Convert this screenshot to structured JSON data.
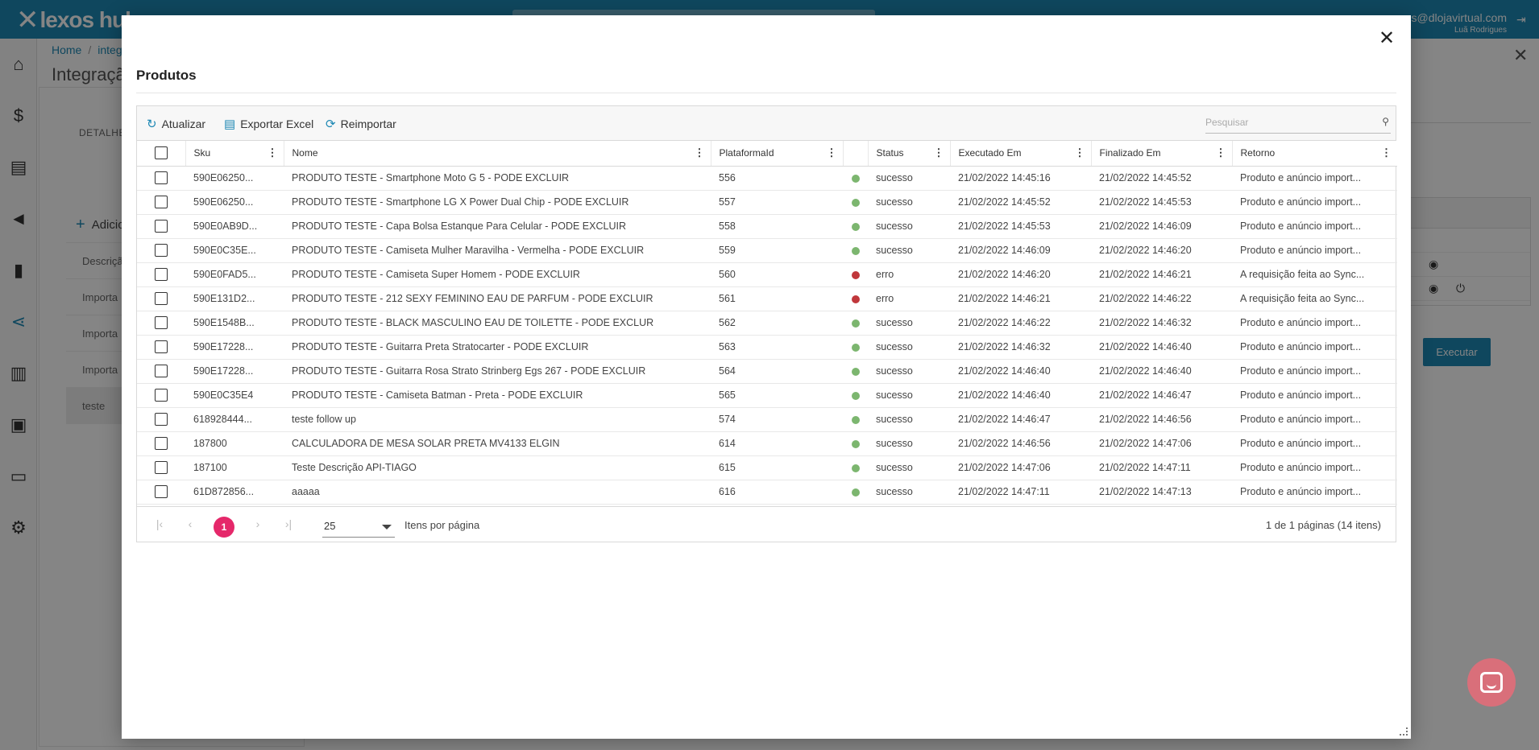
{
  "app": {
    "logo_text": "lexos hub",
    "user_email": "s@dlojavirtual.com",
    "user_name": "Luã Rodrigues"
  },
  "background": {
    "breadcrumb": [
      "Home",
      "integ"
    ],
    "page_title": "Integraçã",
    "detalhe_label": "DETALHE",
    "add_label": "Adicio",
    "list_rows": [
      "Descriçã",
      "Importa",
      "Importa",
      "Importa",
      "teste"
    ],
    "execute_label": "Executar"
  },
  "modal": {
    "title": "Produtos",
    "toolbar": {
      "refresh": "Atualizar",
      "export": "Exportar Excel",
      "reimport": "Reimportar",
      "search_placeholder": "Pesquisar"
    },
    "columns": [
      "Sku",
      "Nome",
      "PlataformaId",
      "Status",
      "Executado Em",
      "Finalizado Em",
      "Retorno"
    ],
    "rows": [
      {
        "sku": "590E06250...",
        "nome": "PRODUTO TESTE - Smartphone Moto G 5 - PODE EXCLUIR",
        "plat": "556",
        "ok": true,
        "status": "sucesso",
        "exec": "21/02/2022 14:45:16",
        "fin": "21/02/2022 14:45:52",
        "ret": "Produto e anúncio import..."
      },
      {
        "sku": "590E06250...",
        "nome": "PRODUTO TESTE - Smartphone LG X Power Dual Chip - PODE EXCLUIR",
        "plat": "557",
        "ok": true,
        "status": "sucesso",
        "exec": "21/02/2022 14:45:52",
        "fin": "21/02/2022 14:45:53",
        "ret": "Produto e anúncio import..."
      },
      {
        "sku": "590E0AB9D...",
        "nome": "PRODUTO TESTE - Capa Bolsa Estanque Para Celular - PODE EXCLUIR",
        "plat": "558",
        "ok": true,
        "status": "sucesso",
        "exec": "21/02/2022 14:45:53",
        "fin": "21/02/2022 14:46:09",
        "ret": "Produto e anúncio import..."
      },
      {
        "sku": "590E0C35E...",
        "nome": "PRODUTO TESTE - Camiseta Mulher Maravilha - Vermelha - PODE EXCLUIR",
        "plat": "559",
        "ok": true,
        "status": "sucesso",
        "exec": "21/02/2022 14:46:09",
        "fin": "21/02/2022 14:46:20",
        "ret": "Produto e anúncio import..."
      },
      {
        "sku": "590E0FAD5...",
        "nome": "PRODUTO TESTE - Camiseta Super Homem - PODE EXCLUIR",
        "plat": "560",
        "ok": false,
        "status": "erro",
        "exec": "21/02/2022 14:46:20",
        "fin": "21/02/2022 14:46:21",
        "ret": "A requisição feita ao Sync..."
      },
      {
        "sku": "590E131D2...",
        "nome": "PRODUTO TESTE - 212 SEXY FEMININO EAU DE PARFUM - PODE EXCLUIR",
        "plat": "561",
        "ok": false,
        "status": "erro",
        "exec": "21/02/2022 14:46:21",
        "fin": "21/02/2022 14:46:22",
        "ret": "A requisição feita ao Sync..."
      },
      {
        "sku": "590E1548B...",
        "nome": "PRODUTO TESTE - BLACK MASCULINO EAU DE TOILETTE - PODE EXCLUR",
        "plat": "562",
        "ok": true,
        "status": "sucesso",
        "exec": "21/02/2022 14:46:22",
        "fin": "21/02/2022 14:46:32",
        "ret": "Produto e anúncio import..."
      },
      {
        "sku": "590E17228...",
        "nome": "PRODUTO TESTE - Guitarra Preta Stratocarter - PODE EXCLUIR",
        "plat": "563",
        "ok": true,
        "status": "sucesso",
        "exec": "21/02/2022 14:46:32",
        "fin": "21/02/2022 14:46:40",
        "ret": "Produto e anúncio import..."
      },
      {
        "sku": "590E17228...",
        "nome": "PRODUTO TESTE - Guitarra Rosa Strato Strinberg Egs 267 - PODE EXCLUIR",
        "plat": "564",
        "ok": true,
        "status": "sucesso",
        "exec": "21/02/2022 14:46:40",
        "fin": "21/02/2022 14:46:40",
        "ret": "Produto e anúncio import..."
      },
      {
        "sku": "590E0C35E4",
        "nome": "PRODUTO TESTE - Camiseta Batman - Preta - PODE EXCLUIR",
        "plat": "565",
        "ok": true,
        "status": "sucesso",
        "exec": "21/02/2022 14:46:40",
        "fin": "21/02/2022 14:46:47",
        "ret": "Produto e anúncio import..."
      },
      {
        "sku": "618928444...",
        "nome": "teste follow up",
        "plat": "574",
        "ok": true,
        "status": "sucesso",
        "exec": "21/02/2022 14:46:47",
        "fin": "21/02/2022 14:46:56",
        "ret": "Produto e anúncio import..."
      },
      {
        "sku": "187800",
        "nome": "CALCULADORA DE MESA SOLAR PRETA MV4133 ELGIN",
        "plat": "614",
        "ok": true,
        "status": "sucesso",
        "exec": "21/02/2022 14:46:56",
        "fin": "21/02/2022 14:47:06",
        "ret": "Produto e anúncio import..."
      },
      {
        "sku": "187100",
        "nome": "Teste Descrição API-TIAGO",
        "plat": "615",
        "ok": true,
        "status": "sucesso",
        "exec": "21/02/2022 14:47:06",
        "fin": "21/02/2022 14:47:11",
        "ret": "Produto e anúncio import..."
      },
      {
        "sku": "61D872856...",
        "nome": "aaaaa",
        "plat": "616",
        "ok": true,
        "status": "sucesso",
        "exec": "21/02/2022 14:47:11",
        "fin": "21/02/2022 14:47:13",
        "ret": "Produto e anúncio import..."
      }
    ],
    "pager": {
      "current_page": "1",
      "page_size": "25",
      "page_size_label": "Itens por página",
      "info": "1 de 1 páginas (14 itens)"
    }
  },
  "colors": {
    "brand": "#1e88b4",
    "success_dot": "#7cb66f",
    "error_dot": "#c0373b",
    "page_active": "#e5286a"
  }
}
